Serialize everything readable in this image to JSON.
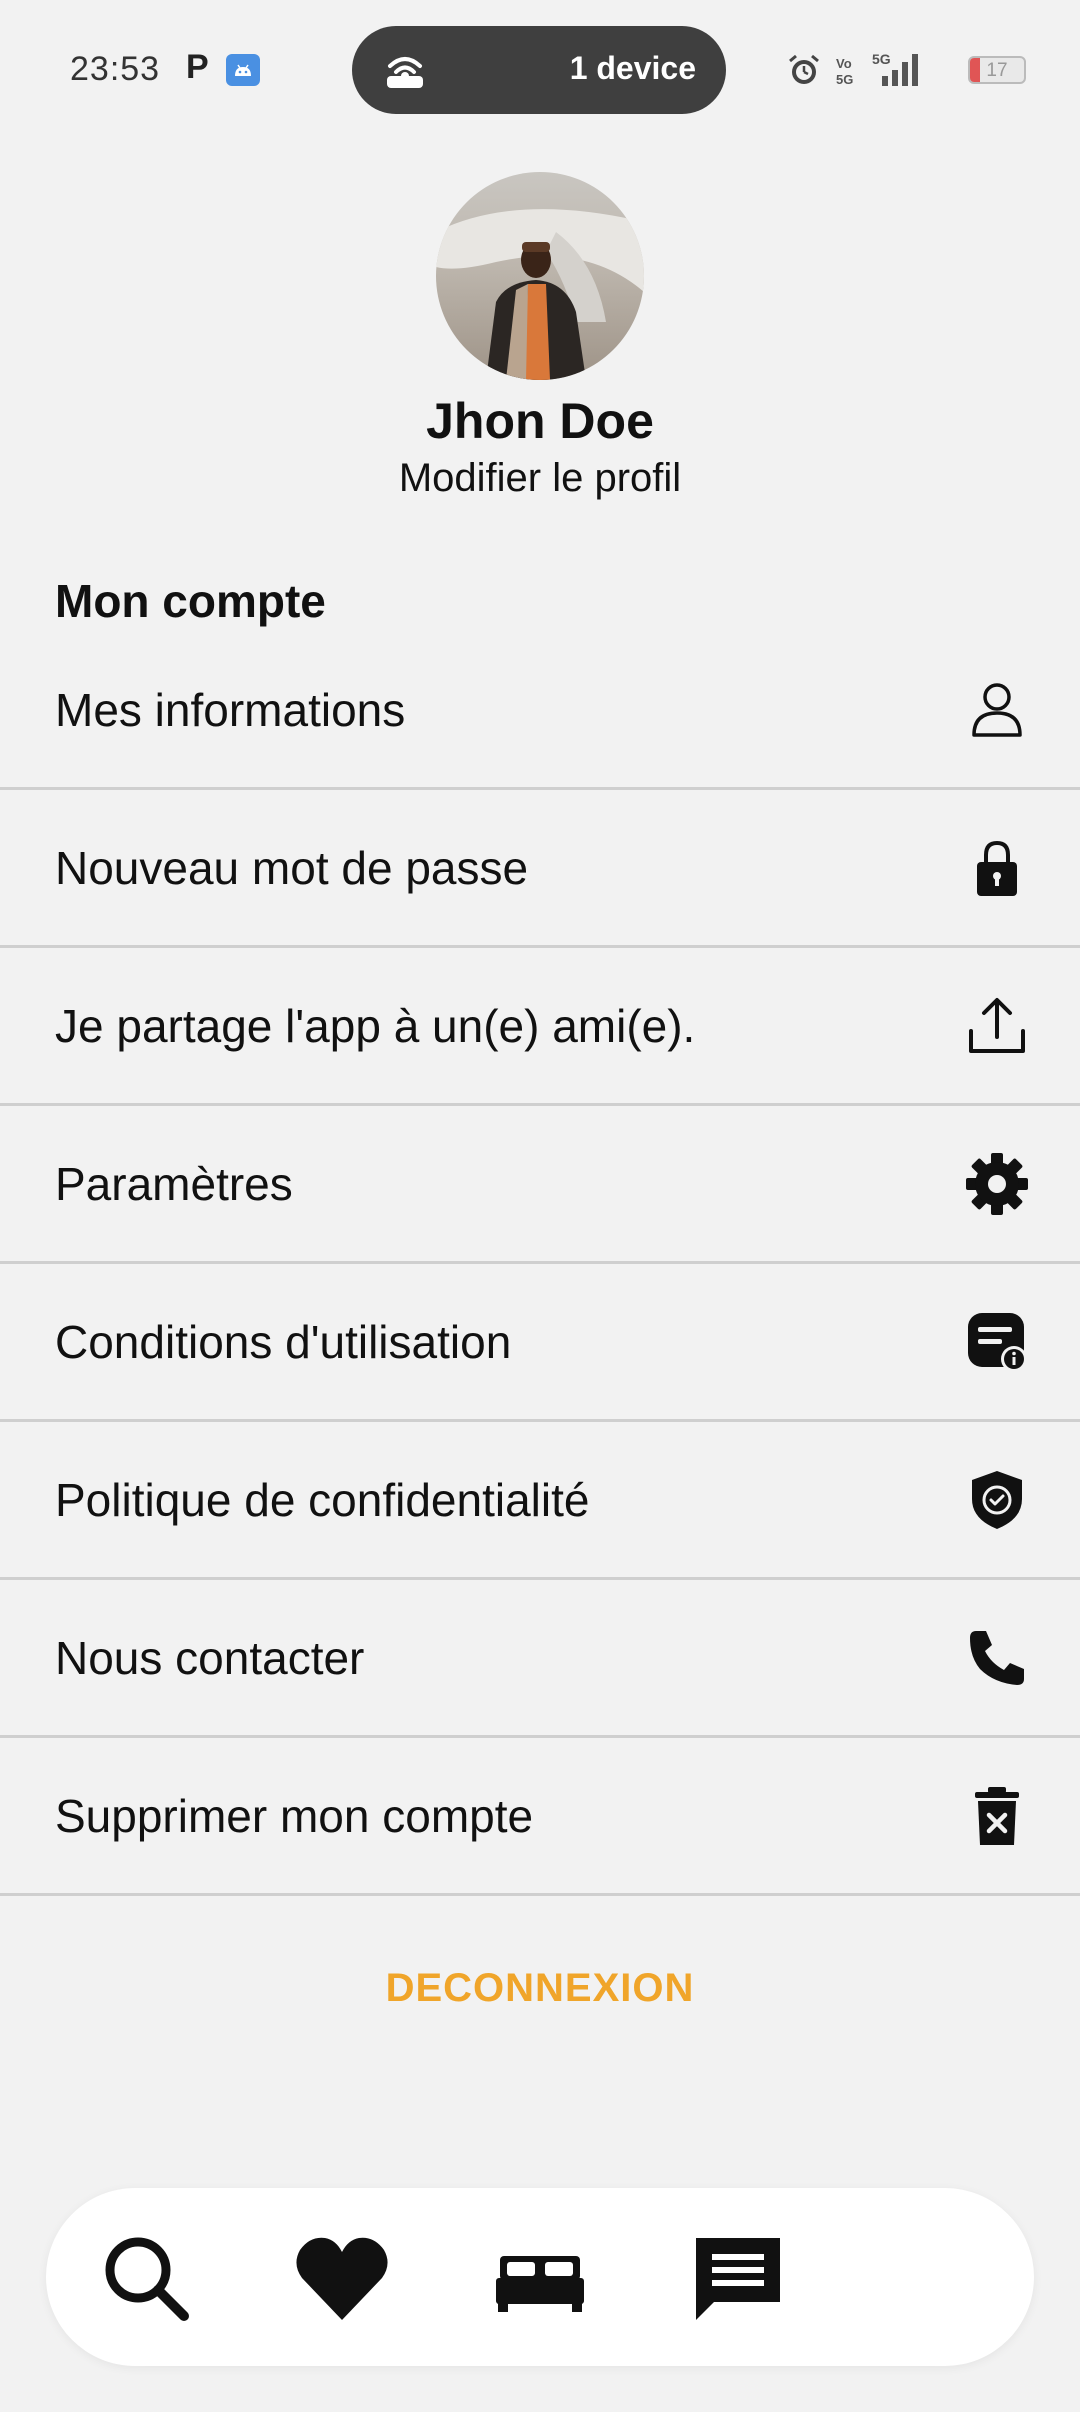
{
  "status_bar": {
    "time": "23:53",
    "notification_letter": "P",
    "island_text": "1 device",
    "battery": "17"
  },
  "profile": {
    "name": "Jhon Doe",
    "edit_label": "Modifier le profil"
  },
  "section_title": "Mon compte",
  "menu": [
    {
      "label": "Mes informations",
      "icon": "user-icon"
    },
    {
      "label": "Nouveau mot de passe",
      "icon": "lock-icon"
    },
    {
      "label": "Je partage l'app à un(e) ami(e).",
      "icon": "share-upload-icon"
    },
    {
      "label": "Paramètres",
      "icon": "gear-icon"
    },
    {
      "label": "Conditions d'utilisation",
      "icon": "terms-info-icon"
    },
    {
      "label": "Politique de confidentialité",
      "icon": "shield-check-icon"
    },
    {
      "label": "Nous contacter",
      "icon": "phone-icon"
    },
    {
      "label": "Supprimer mon compte",
      "icon": "trash-icon"
    }
  ],
  "logout_label": "DECONNEXION",
  "colors": {
    "accent": "#f0a52a",
    "background": "#f2f2f2"
  },
  "bottom_nav": [
    {
      "icon": "search-icon"
    },
    {
      "icon": "heart-icon"
    },
    {
      "icon": "bed-icon"
    },
    {
      "icon": "chat-icon"
    }
  ]
}
